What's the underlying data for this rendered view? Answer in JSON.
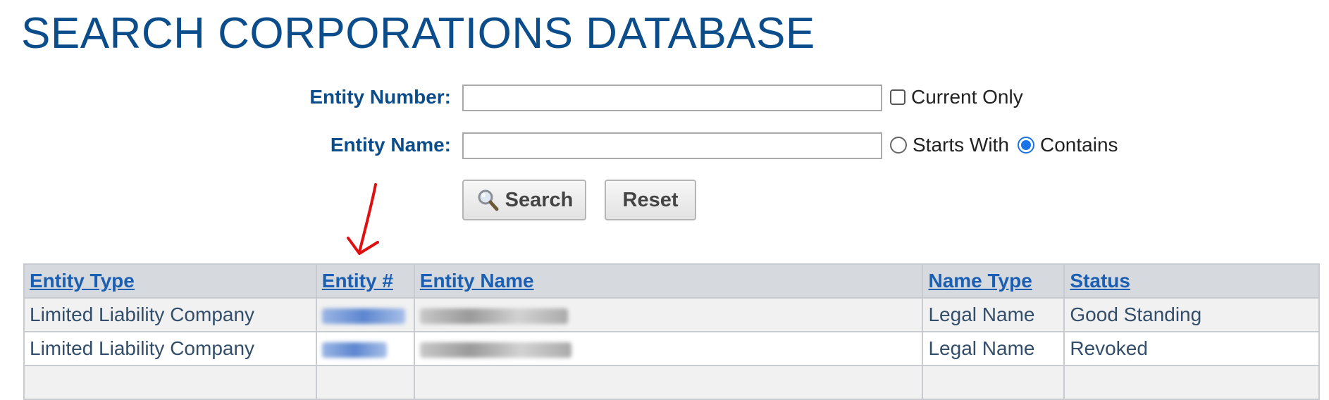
{
  "page": {
    "title": "SEARCH CORPORATIONS DATABASE"
  },
  "form": {
    "entity_number": {
      "label": "Entity Number:",
      "value": "",
      "current_only_label": "Current Only",
      "current_only_checked": false
    },
    "entity_name": {
      "label": "Entity Name:",
      "value": "",
      "options": [
        "Starts With",
        "Contains"
      ],
      "selected": "Contains"
    },
    "search_button": "Search",
    "reset_button": "Reset"
  },
  "table": {
    "headers": [
      "Entity Type",
      "Entity #",
      "Entity Name",
      "Name Type",
      "Status"
    ],
    "rows": [
      {
        "entity_type": "Limited Liability Company",
        "name_type": "Legal Name",
        "status": "Good Standing"
      },
      {
        "entity_type": "Limited Liability Company",
        "name_type": "Legal Name",
        "status": "Revoked"
      }
    ]
  },
  "colors": {
    "title": "#0b4d8a",
    "link": "#1a5fb4",
    "header_bg": "#d6d9dd",
    "annotation_arrow": "#e01010",
    "radio_selected": "#1a73e8"
  },
  "icons": {
    "search_button": "magnifier-icon",
    "annotation": "red-arrow-icon"
  }
}
